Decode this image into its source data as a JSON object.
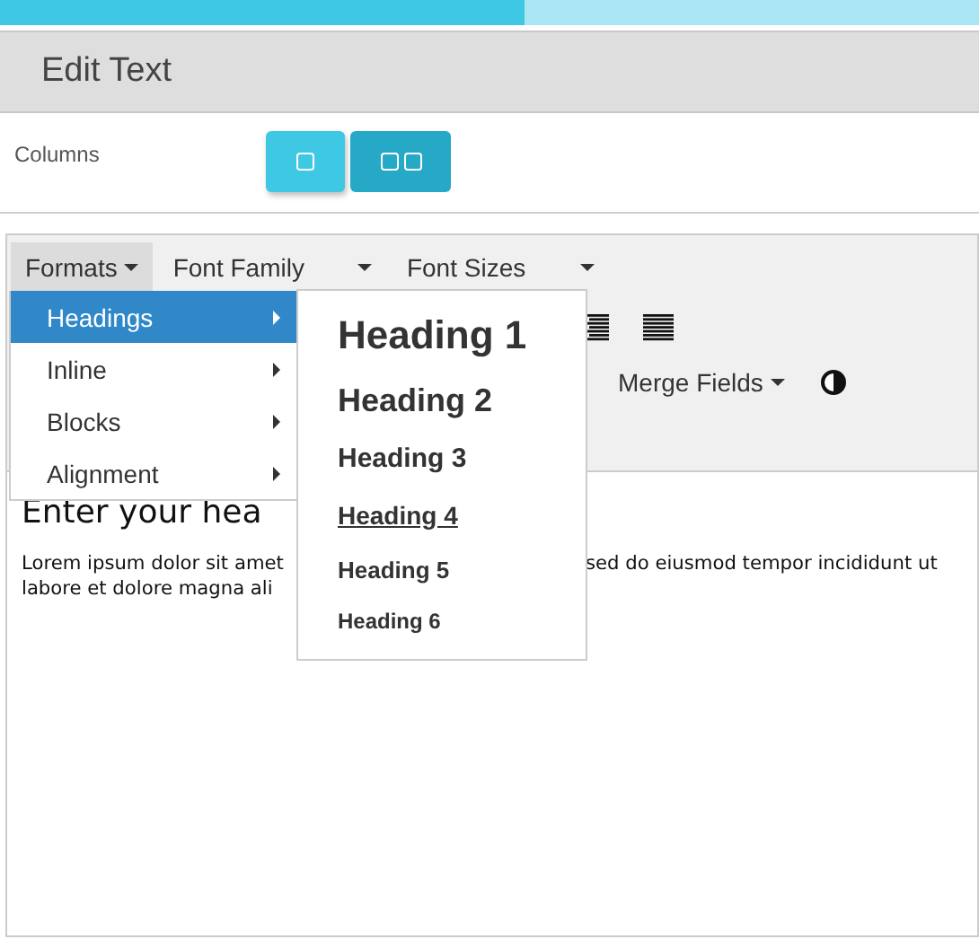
{
  "progress": {
    "level": 0.536
  },
  "header": {
    "title": "Edit Text"
  },
  "columns": {
    "label": "Columns",
    "options": [
      {
        "kind": "one",
        "selected": false
      },
      {
        "kind": "two",
        "selected": true
      }
    ]
  },
  "toolbar": {
    "menus": [
      {
        "label": "Formats",
        "pressed": true
      },
      {
        "label": "Font Family",
        "pressed": false
      },
      {
        "label": "Font Sizes",
        "pressed": false
      }
    ],
    "merge_fields": "Merge Fields"
  },
  "formats_menu": [
    {
      "label": "Headings",
      "selected": true
    },
    {
      "label": "Inline",
      "selected": false
    },
    {
      "label": "Blocks",
      "selected": false
    },
    {
      "label": "Alignment",
      "selected": false
    }
  ],
  "headings_menu": [
    {
      "label": "Heading 1",
      "kind": "h1",
      "selected": false
    },
    {
      "label": "Heading 2",
      "kind": "h2",
      "selected": false
    },
    {
      "label": "Heading 3",
      "kind": "h3",
      "selected": false
    },
    {
      "label": "Heading 4",
      "kind": "h4",
      "selected": true
    },
    {
      "label": "Heading 5",
      "kind": "h5",
      "selected": false
    },
    {
      "label": "Heading 6",
      "kind": "h6",
      "selected": false
    }
  ],
  "content": {
    "heading": "Enter your hea",
    "lines": [
      {
        "left": "Lorem ipsum dolor sit amet",
        "right": "sed do eiusmod tempor incididunt ut"
      },
      {
        "left": "labore et dolore magna ali"
      }
    ]
  }
}
